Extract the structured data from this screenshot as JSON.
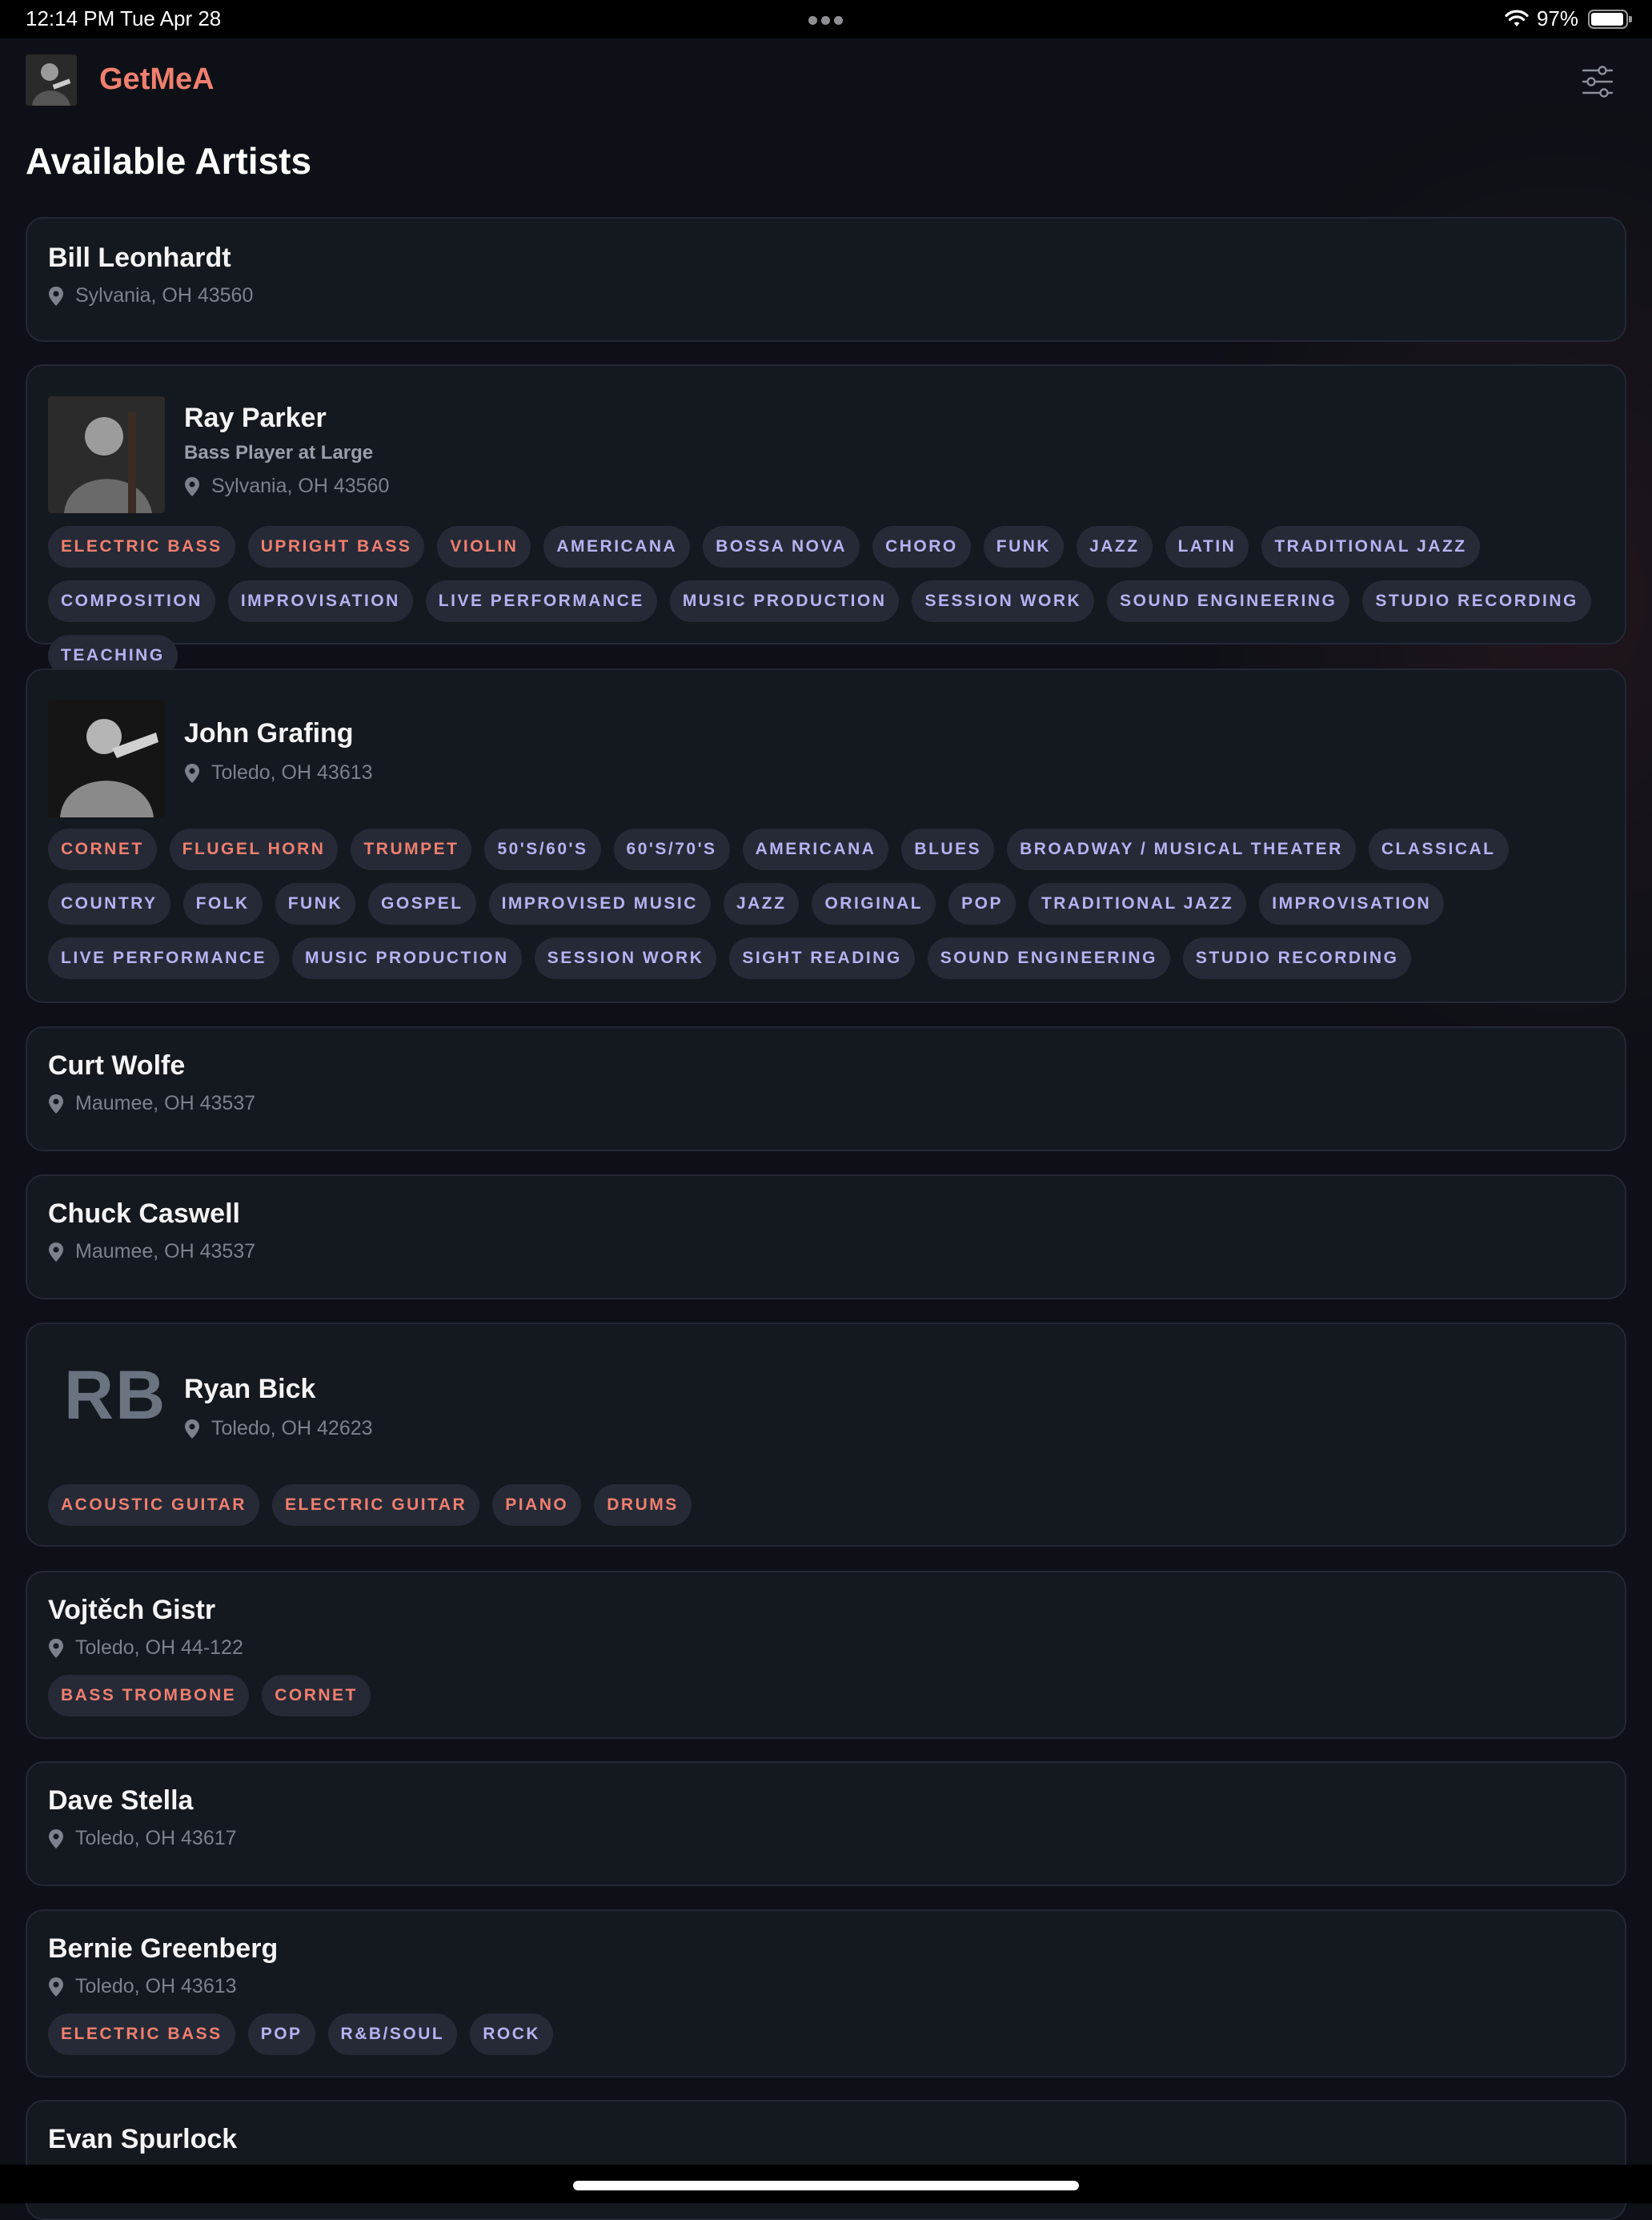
{
  "status_bar": {
    "time": "12:14 PM   Tue Apr 28",
    "battery": "97%"
  },
  "app": {
    "brand": "GetMeA",
    "page_title": "Available Artists"
  },
  "artists": [
    {
      "name": "Bill Leonhardt",
      "location": "Sylvania, OH  43560"
    },
    {
      "name": "Ray Parker",
      "tagline": "Bass Player at Large",
      "location": "Sylvania, OH  43560",
      "tags": [
        "ELECTRIC BASS",
        "UPRIGHT BASS",
        "VIOLIN",
        "AMERICANA",
        "BOSSA NOVA",
        "CHORO",
        "FUNK",
        "JAZZ",
        "LATIN",
        "TRADITIONAL JAZZ",
        "COMPOSITION",
        "IMPROVISATION",
        "LIVE PERFORMANCE",
        "MUSIC PRODUCTION",
        "SESSION WORK",
        "SOUND ENGINEERING",
        "STUDIO RECORDING",
        "TEACHING"
      ]
    },
    {
      "name": "John Grafing",
      "location": "Toledo, OH  43613",
      "tags": [
        "CORNET",
        "FLUGEL HORN",
        "TRUMPET",
        "50'S/60'S",
        "60'S/70'S",
        "AMERICANA",
        "BLUES",
        "BROADWAY / MUSICAL THEATER",
        "CLASSICAL",
        "COUNTRY",
        "FOLK",
        "FUNK",
        "GOSPEL",
        "IMPROVISED MUSIC",
        "JAZZ",
        "ORIGINAL",
        "POP",
        "TRADITIONAL JAZZ",
        "IMPROVISATION",
        "LIVE PERFORMANCE",
        "MUSIC PRODUCTION",
        "SESSION WORK",
        "SIGHT READING",
        "SOUND ENGINEERING",
        "STUDIO RECORDING"
      ]
    },
    {
      "name": "Curt Wolfe",
      "location": "Maumee, OH  43537"
    },
    {
      "name": "Chuck Caswell",
      "location": "Maumee, OH  43537"
    },
    {
      "name": "Ryan Bick",
      "initials": "RB",
      "location": "Toledo, OH  42623",
      "tags": [
        "ACOUSTIC GUITAR",
        "ELECTRIC GUITAR",
        "PIANO",
        "DRUMS"
      ]
    },
    {
      "name": "Vojtěch Gistr",
      "location": "Toledo, OH  44-122",
      "tags": [
        "BASS TROMBONE",
        "CORNET"
      ]
    },
    {
      "name": "Dave Stella",
      "location": "Toledo, OH  43617"
    },
    {
      "name": "Bernie Greenberg",
      "location": "Toledo, OH  43613",
      "tags": [
        "ELECTRIC BASS",
        "POP",
        "R&B/SOUL",
        "ROCK"
      ]
    },
    {
      "name": "Evan Spurlock"
    }
  ],
  "colors": {
    "background": "#0d1016",
    "card": "#14181f",
    "brand": "#f07f6f",
    "instrument_tag": "#f07f6f",
    "genre_tag": "#b6b2f2",
    "tag_bg": "#262a36"
  },
  "icons": [
    "wifi-icon",
    "battery-icon",
    "sliders-icon",
    "location-pin-icon"
  ]
}
